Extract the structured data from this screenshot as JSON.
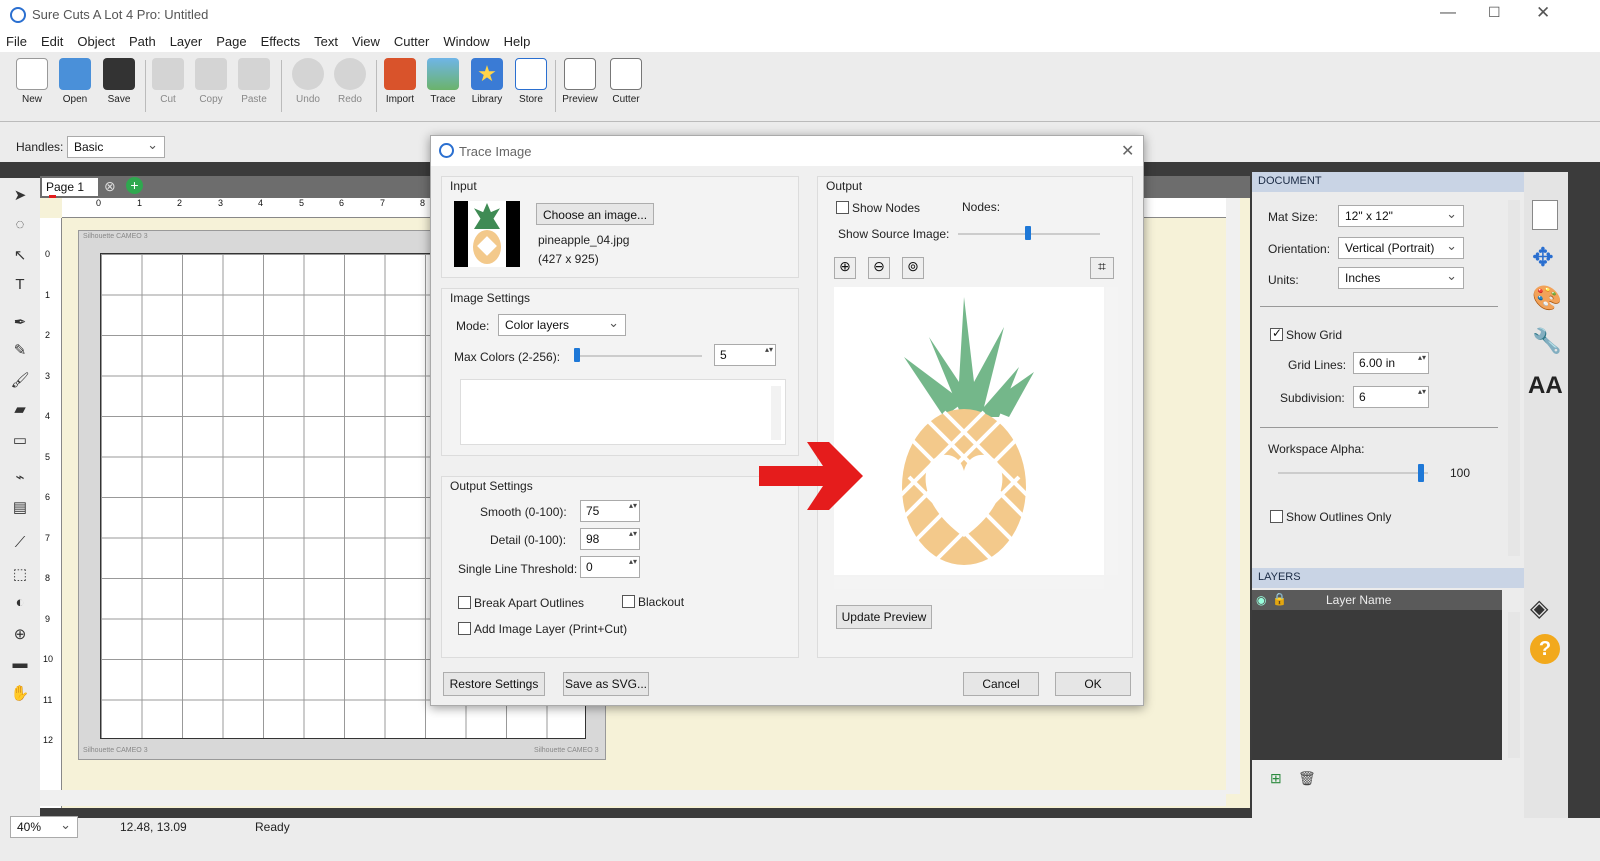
{
  "app": {
    "title": "Sure Cuts A Lot 4 Pro: Untitled"
  },
  "menu": [
    "File",
    "Edit",
    "Object",
    "Path",
    "Layer",
    "Page",
    "Effects",
    "Text",
    "View",
    "Cutter",
    "Window",
    "Help"
  ],
  "toolbar": {
    "new": "New",
    "open": "Open",
    "save": "Save",
    "cut": "Cut",
    "copy": "Copy",
    "paste": "Paste",
    "undo": "Undo",
    "redo": "Redo",
    "import": "Import",
    "trace": "Trace",
    "library": "Library",
    "store": "Store",
    "preview": "Preview",
    "cutter": "Cutter"
  },
  "options": {
    "handles_label": "Handles:",
    "handles_value": "Basic"
  },
  "pagetab": {
    "label": "Page 1"
  },
  "ruler": {
    "h": [
      "0",
      "1",
      "2",
      "3",
      "4",
      "5",
      "6",
      "7",
      "8"
    ],
    "v": [
      "0",
      "1",
      "2",
      "3",
      "4",
      "5",
      "6",
      "7",
      "8",
      "9",
      "10",
      "11",
      "12"
    ]
  },
  "mat": {
    "brand": "Silhouette CAMEO 3"
  },
  "status": {
    "zoom": "40%",
    "coords": "12.48, 13.09",
    "state": "Ready"
  },
  "document": {
    "title": "DOCUMENT",
    "mat_size_label": "Mat Size:",
    "mat_size": "12\" x 12\"",
    "orientation_label": "Orientation:",
    "orientation": "Vertical (Portrait)",
    "units_label": "Units:",
    "units": "Inches",
    "show_grid": "Show Grid",
    "grid_lines_label": "Grid Lines:",
    "grid_lines": "6.00 in",
    "subdivision_label": "Subdivision:",
    "subdivision": "6",
    "workspace_alpha_label": "Workspace Alpha:",
    "workspace_alpha": "100",
    "show_outlines": "Show Outlines Only"
  },
  "layers": {
    "title": "LAYERS",
    "col": "Layer Name"
  },
  "dialog": {
    "title": "Trace Image",
    "input_label": "Input",
    "choose": "Choose an image...",
    "filename": "pineapple_04.jpg",
    "dims": "(427 x 925)",
    "image_settings": "Image Settings",
    "mode_label": "Mode:",
    "mode": "Color layers",
    "max_colors_label": "Max Colors (2-256):",
    "max_colors": "5",
    "output_settings": "Output Settings",
    "smooth_label": "Smooth (0-100):",
    "smooth": "75",
    "detail_label": "Detail (0-100):",
    "detail": "98",
    "slt_label": "Single Line Threshold:",
    "slt": "0",
    "break_apart": "Break Apart Outlines",
    "blackout": "Blackout",
    "add_image_layer": "Add Image Layer (Print+Cut)",
    "output_label": "Output",
    "show_nodes": "Show Nodes",
    "nodes_label": "Nodes:",
    "show_source": "Show Source Image:",
    "update_preview": "Update Preview",
    "restore": "Restore Settings",
    "save_svg": "Save as SVG...",
    "cancel": "Cancel",
    "ok": "OK"
  },
  "colors": {
    "accent": "#1e78d7",
    "pineapple_leaf": "#74b78a",
    "pineapple_body": "#f3c98b",
    "arrow": "#e51c1c"
  }
}
